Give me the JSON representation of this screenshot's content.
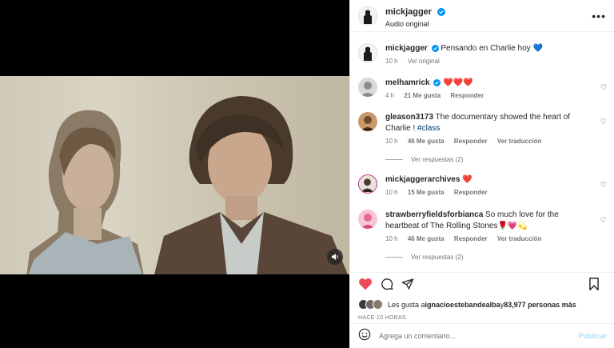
{
  "header": {
    "username": "mickjagger",
    "subtitle": "Audio original",
    "more_icon": "more-horizontal-icon"
  },
  "caption": {
    "username": "mickjagger",
    "text": "Pensando en Charlie hoy 💙",
    "time": "10 h",
    "see_original": "Ver original"
  },
  "comments": [
    {
      "username": "melhamrick",
      "verified": true,
      "text": "❤️❤️❤️",
      "time": "4 h",
      "likes": "21 Me gusta",
      "reply": "Responder",
      "translate": ""
    },
    {
      "username": "gleason3173",
      "text_main": "The documentary showed the heart of Charlie ! ",
      "hashtag": "#class",
      "time": "10 h",
      "likes": "46 Me gusta",
      "reply": "Responder",
      "translate": "Ver traducción",
      "view_replies": "Ver respuestas (2)"
    },
    {
      "username": "mickjaggerarchives",
      "text": "❤️",
      "time": "10 h",
      "likes": "15 Me gusta",
      "reply": "Responder"
    },
    {
      "username": "strawberryfieldsforbianca",
      "text": "So much love for the heartbeat of The Rolling Stones🌹💗💫",
      "time": "10 h",
      "likes": "46 Me gusta",
      "reply": "Responder",
      "translate": "Ver traducción",
      "view_replies": "Ver respuestas (2)"
    }
  ],
  "likes": {
    "prefix": "Les gusta a ",
    "user": "ignacioestebandealba",
    "middle": " y ",
    "count": "83,977 personas más"
  },
  "time_ago": "HACE 10 HORAS",
  "compose": {
    "placeholder": "Agrega un comentario...",
    "publish": "Publicar"
  },
  "colors": {
    "like_red": "#ed4956",
    "verified_blue": "#0095f6",
    "link": "#00376b"
  }
}
